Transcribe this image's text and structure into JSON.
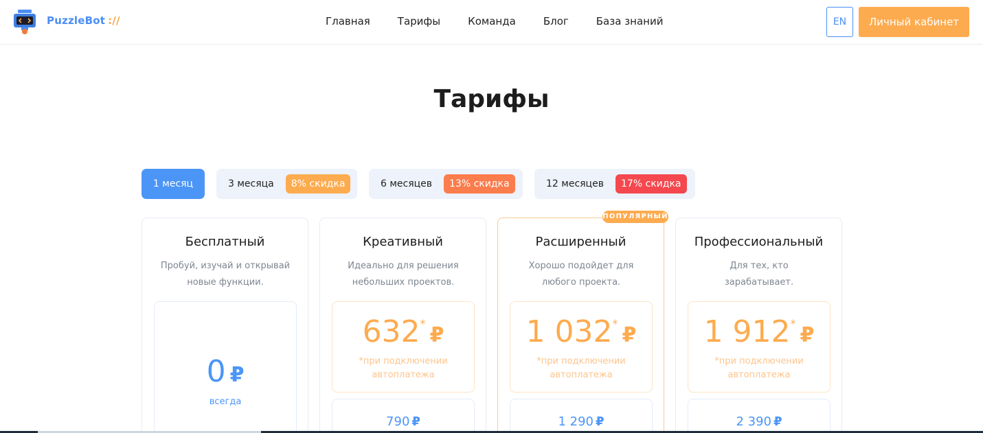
{
  "header": {
    "brand": "PuzzleBot",
    "brand_suffix": "://",
    "nav": [
      "Главная",
      "Тарифы",
      "Команда",
      "Блог",
      "База знаний"
    ],
    "lang": "EN",
    "cabinet": "Личный кабинет",
    "colors": {
      "brand_blue": "#4b8ef5",
      "accent_orange": "#fdab4f"
    }
  },
  "page": {
    "title": "Тарифы"
  },
  "periods": [
    {
      "label": "1 месяц",
      "active": true
    },
    {
      "label": "3 месяца",
      "discount": "8% скидка",
      "color": "#fdab4f"
    },
    {
      "label": "6 месяцев",
      "discount": "13% скидка",
      "color": "#fb7c4c"
    },
    {
      "label": "12 месяцев",
      "discount": "17% скидка",
      "color": "#f4484e"
    }
  ],
  "popular_label": "ПОПУЛЯРНЫЙ",
  "plans": [
    {
      "title": "Бесплатный",
      "desc1": "Пробуй, изучай и открывай",
      "desc2": "новые функции.",
      "price": "0",
      "currency": "₽",
      "note": "всегда"
    },
    {
      "title": "Креативный",
      "desc1": "Идеально для решения",
      "desc2": "небольших проектов.",
      "price": "632",
      "star": "*",
      "currency": "₽",
      "note1": "*при подключении",
      "note2": "автоплатежа",
      "regular_price": "790",
      "regular_currency": "₽"
    },
    {
      "title": "Расширенный",
      "desc1": "Хорошо подойдет для",
      "desc2": "любого проекта.",
      "price": "1 032",
      "star": "*",
      "currency": "₽",
      "note1": "*при подключении",
      "note2": "автоплатежа",
      "regular_price": "1 290",
      "regular_currency": "₽"
    },
    {
      "title": "Профессиональный",
      "desc1": "Для тех, кто",
      "desc2": "зарабатывает.",
      "price": "1 912",
      "star": "*",
      "currency": "₽",
      "note1": "*при подключении",
      "note2": "автоплатежа",
      "regular_price": "2 390",
      "regular_currency": "₽"
    }
  ]
}
